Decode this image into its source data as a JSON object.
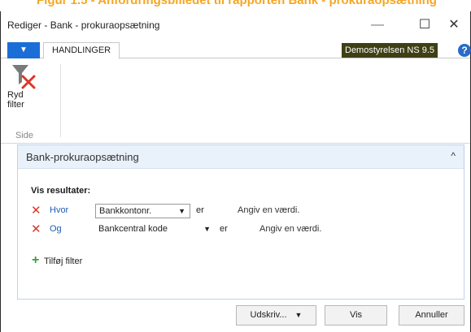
{
  "caption": "Figur 1.5 - Anfordringsbilledet til rapporten Bank - prokuraopsætning",
  "window": {
    "title": "Rediger - Bank - prokuraopsætning",
    "controls": {
      "minimize": "—",
      "maximize": "☐",
      "close": "✕"
    }
  },
  "ribbon": {
    "app_menu": "▼",
    "tab": "HANDLINGER",
    "company": "Demostyrelsen NS 9.5",
    "help": "?",
    "clear_filter_line1": "Ryd",
    "clear_filter_line2": "filter",
    "group_label": "Side"
  },
  "panel": {
    "title": "Bank-prokuraopsætning",
    "collapse": "^",
    "show_results": "Vis resultater:",
    "filters": [
      {
        "link": "Hvor",
        "field": "Bankkontonr.",
        "op": "er",
        "value": "Angiv en værdi."
      },
      {
        "link": "Og",
        "field": "Bankcentral kode",
        "op": "er",
        "value": "Angiv en værdi."
      }
    ],
    "add_filter": "Tilføj filter"
  },
  "buttons": {
    "print": "Udskriv...",
    "preview": "Vis",
    "cancel": "Annuller"
  },
  "colors": {
    "caption": "#f5a623",
    "app_button": "#1b6ed6",
    "company_badge": "#3f3f16",
    "link": "#1e5fb3",
    "remove_x": "#d9372b",
    "add_plus": "#3e9b3e",
    "panel_header": "#e9f1fa"
  }
}
